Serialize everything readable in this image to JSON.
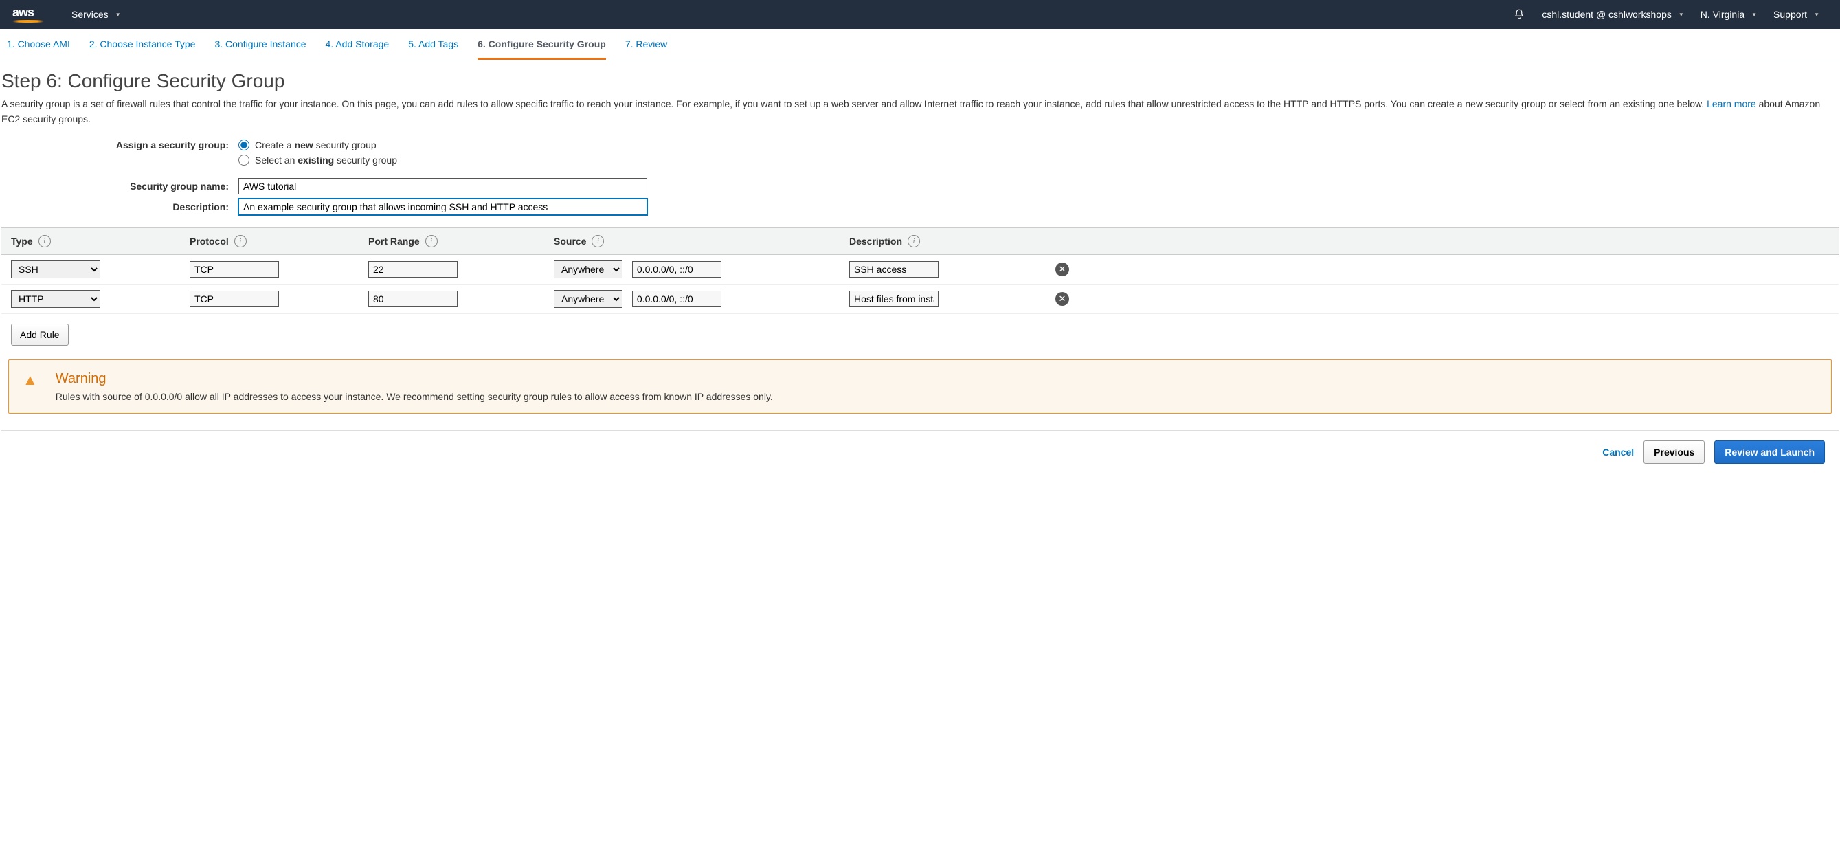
{
  "topnav": {
    "services": "Services",
    "account": "cshl.student @ cshlworkshops",
    "region": "N. Virginia",
    "support": "Support"
  },
  "wizard": {
    "steps": [
      "1. Choose AMI",
      "2. Choose Instance Type",
      "3. Configure Instance",
      "4. Add Storage",
      "5. Add Tags",
      "6. Configure Security Group",
      "7. Review"
    ],
    "active_index": 5
  },
  "heading": "Step 6: Configure Security Group",
  "intro_text": "A security group is a set of firewall rules that control the traffic for your instance. On this page, you can add rules to allow specific traffic to reach your instance. For example, if you want to set up a web server and allow Internet traffic to reach your instance, add rules that allow unrestricted access to the HTTP and HTTPS ports. You can create a new security group or select from an existing one below. ",
  "learn_more_text": "Learn more",
  "intro_tail": " about Amazon EC2 security groups.",
  "assign": {
    "label": "Assign a security group:",
    "radios": {
      "create_prefix": "Create a ",
      "create_bold": "new",
      "create_suffix": " security group",
      "select_prefix": "Select an ",
      "select_bold": "existing",
      "select_suffix": " security group",
      "selected": "create"
    }
  },
  "name_field": {
    "label": "Security group name:",
    "value": "AWS tutorial"
  },
  "desc_field": {
    "label": "Description:",
    "value": "An example security group that allows incoming SSH and HTTP access"
  },
  "table": {
    "headers": {
      "type": "Type",
      "protocol": "Protocol",
      "port": "Port Range",
      "source": "Source",
      "description": "Description"
    },
    "rows": [
      {
        "type": "SSH",
        "protocol": "TCP",
        "port": "22",
        "source_sel": "Anywhere",
        "source_ip": "0.0.0.0/0, ::/0",
        "description": "SSH access"
      },
      {
        "type": "HTTP",
        "protocol": "TCP",
        "port": "80",
        "source_sel": "Anywhere",
        "source_ip": "0.0.0.0/0, ::/0",
        "description": "Host files from instance"
      }
    ],
    "add_rule": "Add Rule"
  },
  "warning": {
    "title": "Warning",
    "message": "Rules with source of 0.0.0.0/0 allow all IP addresses to access your instance. We recommend setting security group rules to allow access from known IP addresses only."
  },
  "footer": {
    "cancel": "Cancel",
    "previous": "Previous",
    "review": "Review and Launch"
  }
}
